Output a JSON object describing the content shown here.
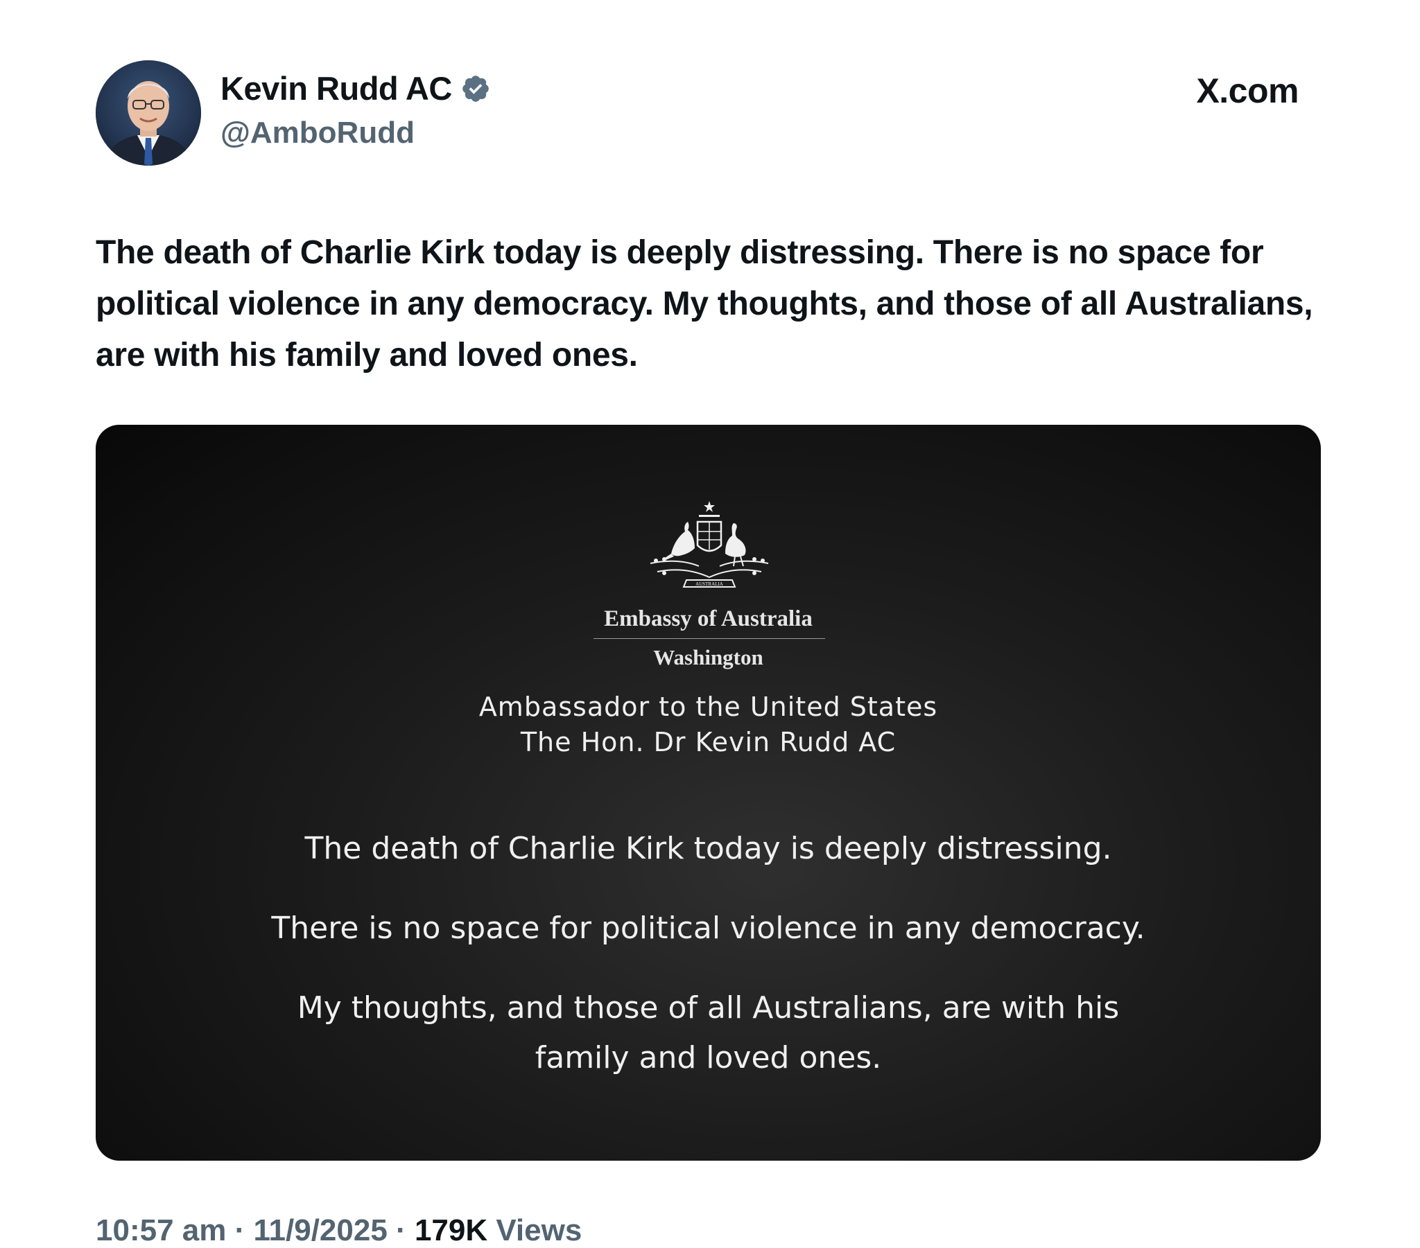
{
  "author": {
    "display_name": "Kevin Rudd AC",
    "handle": "@AmboRudd",
    "verified": true,
    "verified_color": "#5b7083",
    "avatar_icon": "portrait-avatar"
  },
  "site_label": "X.com",
  "tweet_text": "The death of Charlie Kirk today is deeply distressing. There is no space for political violence in any democracy. My thoughts, and those of all Australians, are with his family and loved ones.",
  "media": {
    "crest_icon": "australian-coat-of-arms-icon",
    "crest_text": "AUSTRALIA",
    "embassy_name": "Embassy of Australia",
    "embassy_city": "Washington",
    "ambassador_title": "Ambassador to the United States",
    "ambassador_name": "The Hon. Dr Kevin Rudd AC",
    "statements": [
      "The death of Charlie Kirk today is deeply distressing.",
      "There is no space for political violence in any democracy.",
      "My thoughts, and those of all Australians, are with his family and loved ones."
    ]
  },
  "meta": {
    "time": "10:57 am",
    "date": "11/9/2025",
    "separator": "·",
    "views_count": "179K",
    "views_label": "Views"
  }
}
